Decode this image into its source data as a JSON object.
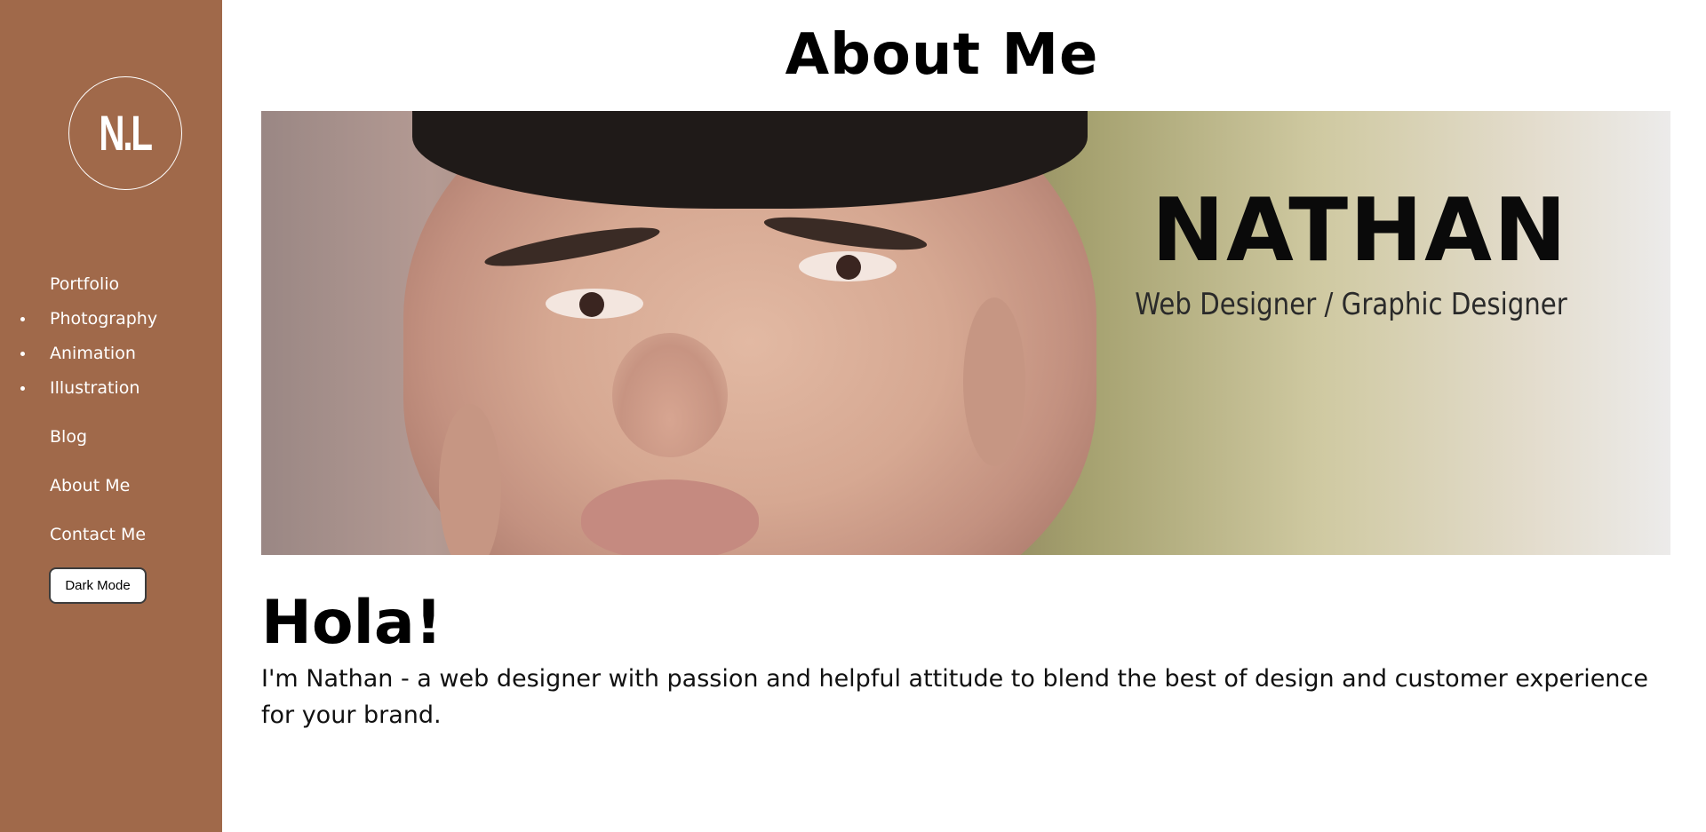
{
  "sidebar": {
    "logo_text": "N.L",
    "nav": [
      {
        "label": "Portfolio"
      },
      {
        "label": "Photography"
      },
      {
        "label": "Animation"
      },
      {
        "label": "Illustration"
      },
      {
        "label": "Blog"
      },
      {
        "label": "About Me"
      },
      {
        "label": "Contact Me"
      }
    ],
    "dark_mode_label": "Dark Mode",
    "background_color": "#a0694a"
  },
  "main": {
    "page_title": "About Me",
    "banner": {
      "name": "NATHAN",
      "role": "Web Designer / Graphic Designer"
    },
    "greeting": "Hola!",
    "intro": "I'm Nathan - a web designer with passion and helpful attitude to blend the best of design and customer experience for your brand."
  }
}
